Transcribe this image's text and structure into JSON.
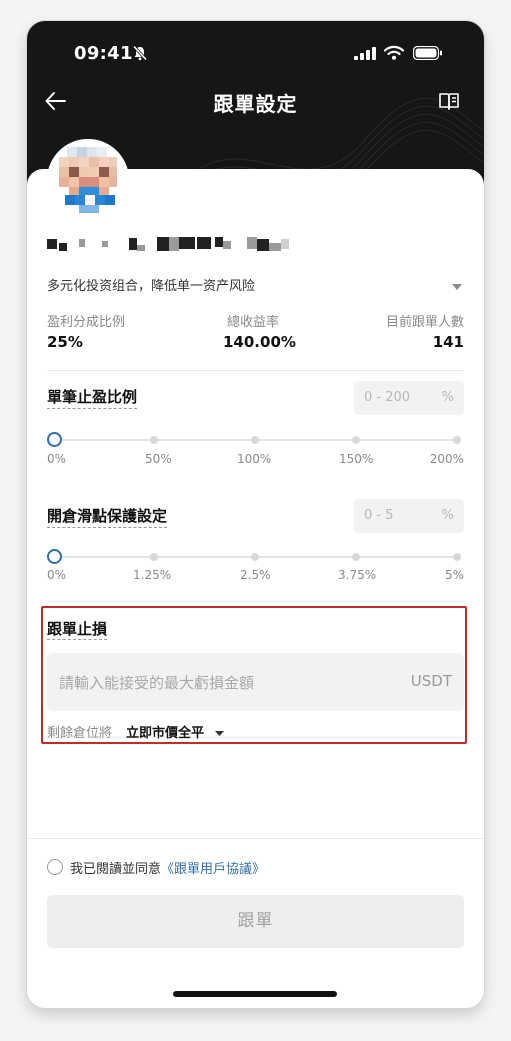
{
  "status_bar": {
    "time": "09:41"
  },
  "nav": {
    "title": "跟單設定"
  },
  "trader": {
    "description": "多元化投资组合，降低单一资产风险",
    "stats": [
      {
        "label": "盈利分成比例",
        "value": "25%"
      },
      {
        "label": "總收益率",
        "value": "140.00%"
      },
      {
        "label": "目前跟單人數",
        "value": "141"
      }
    ]
  },
  "take_profit": {
    "title": "單筆止盈比例",
    "range_placeholder": "0 - 200",
    "unit": "%",
    "ticks": [
      "0%",
      "50%",
      "100%",
      "150%",
      "200%"
    ],
    "slider_value": 0
  },
  "slippage": {
    "title": "開倉滑點保護設定",
    "range_placeholder": "0 - 5",
    "unit": "%",
    "ticks": [
      "0%",
      "1.25%",
      "2.5%",
      "3.75%",
      "5%"
    ],
    "slider_value": 0
  },
  "stop_loss": {
    "title": "跟單止損",
    "input_placeholder": "請輸入能接受的最大虧損金額",
    "input_unit": "USDT",
    "remain_label": "剩餘倉位將",
    "remain_action": "立即市價全平"
  },
  "agreement": {
    "prefix": "我已閱讀並同意",
    "link": "《跟單用戶協議》"
  },
  "follow_button": "跟單",
  "colors": {
    "accent": "#2f6fa6",
    "highlight_box": "#c8292b",
    "header_bg": "#161616"
  }
}
